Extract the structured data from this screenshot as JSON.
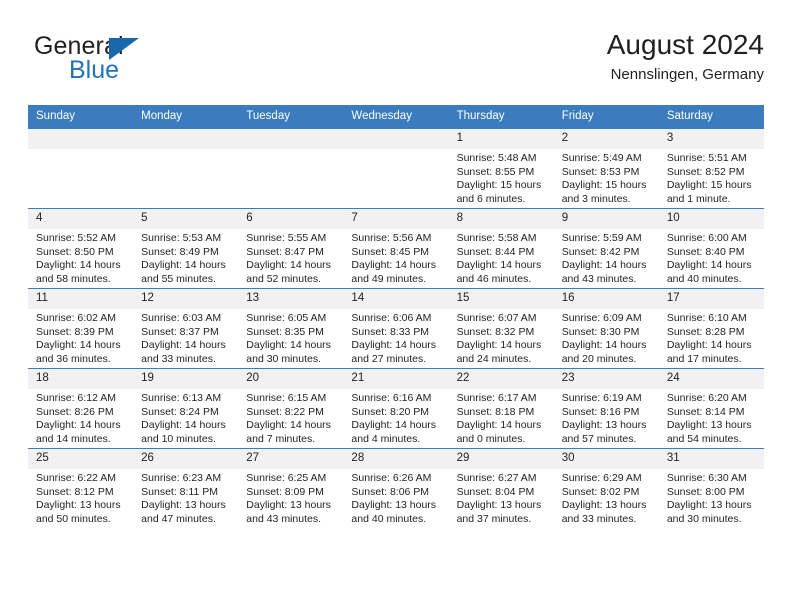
{
  "brand": {
    "name_top": "General",
    "name_bottom": "Blue",
    "flag_icon": "triangle-flag-icon",
    "accent_color": "#2272b8"
  },
  "header": {
    "title": "August 2024",
    "subtitle": "Nennslingen, Germany"
  },
  "calendar": {
    "header_color": "#3a7cbe",
    "daynum_band_color": "#f1f1f1",
    "weekdays": [
      "Sunday",
      "Monday",
      "Tuesday",
      "Wednesday",
      "Thursday",
      "Friday",
      "Saturday"
    ],
    "weeks": [
      [
        {
          "day": "",
          "lines": []
        },
        {
          "day": "",
          "lines": []
        },
        {
          "day": "",
          "lines": []
        },
        {
          "day": "",
          "lines": []
        },
        {
          "day": "1",
          "lines": [
            "Sunrise: 5:48 AM",
            "Sunset: 8:55 PM",
            "Daylight: 15 hours",
            "and 6 minutes."
          ]
        },
        {
          "day": "2",
          "lines": [
            "Sunrise: 5:49 AM",
            "Sunset: 8:53 PM",
            "Daylight: 15 hours",
            "and 3 minutes."
          ]
        },
        {
          "day": "3",
          "lines": [
            "Sunrise: 5:51 AM",
            "Sunset: 8:52 PM",
            "Daylight: 15 hours",
            "and 1 minute."
          ]
        }
      ],
      [
        {
          "day": "4",
          "lines": [
            "Sunrise: 5:52 AM",
            "Sunset: 8:50 PM",
            "Daylight: 14 hours",
            "and 58 minutes."
          ]
        },
        {
          "day": "5",
          "lines": [
            "Sunrise: 5:53 AM",
            "Sunset: 8:49 PM",
            "Daylight: 14 hours",
            "and 55 minutes."
          ]
        },
        {
          "day": "6",
          "lines": [
            "Sunrise: 5:55 AM",
            "Sunset: 8:47 PM",
            "Daylight: 14 hours",
            "and 52 minutes."
          ]
        },
        {
          "day": "7",
          "lines": [
            "Sunrise: 5:56 AM",
            "Sunset: 8:45 PM",
            "Daylight: 14 hours",
            "and 49 minutes."
          ]
        },
        {
          "day": "8",
          "lines": [
            "Sunrise: 5:58 AM",
            "Sunset: 8:44 PM",
            "Daylight: 14 hours",
            "and 46 minutes."
          ]
        },
        {
          "day": "9",
          "lines": [
            "Sunrise: 5:59 AM",
            "Sunset: 8:42 PM",
            "Daylight: 14 hours",
            "and 43 minutes."
          ]
        },
        {
          "day": "10",
          "lines": [
            "Sunrise: 6:00 AM",
            "Sunset: 8:40 PM",
            "Daylight: 14 hours",
            "and 40 minutes."
          ]
        }
      ],
      [
        {
          "day": "11",
          "lines": [
            "Sunrise: 6:02 AM",
            "Sunset: 8:39 PM",
            "Daylight: 14 hours",
            "and 36 minutes."
          ]
        },
        {
          "day": "12",
          "lines": [
            "Sunrise: 6:03 AM",
            "Sunset: 8:37 PM",
            "Daylight: 14 hours",
            "and 33 minutes."
          ]
        },
        {
          "day": "13",
          "lines": [
            "Sunrise: 6:05 AM",
            "Sunset: 8:35 PM",
            "Daylight: 14 hours",
            "and 30 minutes."
          ]
        },
        {
          "day": "14",
          "lines": [
            "Sunrise: 6:06 AM",
            "Sunset: 8:33 PM",
            "Daylight: 14 hours",
            "and 27 minutes."
          ]
        },
        {
          "day": "15",
          "lines": [
            "Sunrise: 6:07 AM",
            "Sunset: 8:32 PM",
            "Daylight: 14 hours",
            "and 24 minutes."
          ]
        },
        {
          "day": "16",
          "lines": [
            "Sunrise: 6:09 AM",
            "Sunset: 8:30 PM",
            "Daylight: 14 hours",
            "and 20 minutes."
          ]
        },
        {
          "day": "17",
          "lines": [
            "Sunrise: 6:10 AM",
            "Sunset: 8:28 PM",
            "Daylight: 14 hours",
            "and 17 minutes."
          ]
        }
      ],
      [
        {
          "day": "18",
          "lines": [
            "Sunrise: 6:12 AM",
            "Sunset: 8:26 PM",
            "Daylight: 14 hours",
            "and 14 minutes."
          ]
        },
        {
          "day": "19",
          "lines": [
            "Sunrise: 6:13 AM",
            "Sunset: 8:24 PM",
            "Daylight: 14 hours",
            "and 10 minutes."
          ]
        },
        {
          "day": "20",
          "lines": [
            "Sunrise: 6:15 AM",
            "Sunset: 8:22 PM",
            "Daylight: 14 hours",
            "and 7 minutes."
          ]
        },
        {
          "day": "21",
          "lines": [
            "Sunrise: 6:16 AM",
            "Sunset: 8:20 PM",
            "Daylight: 14 hours",
            "and 4 minutes."
          ]
        },
        {
          "day": "22",
          "lines": [
            "Sunrise: 6:17 AM",
            "Sunset: 8:18 PM",
            "Daylight: 14 hours",
            "and 0 minutes."
          ]
        },
        {
          "day": "23",
          "lines": [
            "Sunrise: 6:19 AM",
            "Sunset: 8:16 PM",
            "Daylight: 13 hours",
            "and 57 minutes."
          ]
        },
        {
          "day": "24",
          "lines": [
            "Sunrise: 6:20 AM",
            "Sunset: 8:14 PM",
            "Daylight: 13 hours",
            "and 54 minutes."
          ]
        }
      ],
      [
        {
          "day": "25",
          "lines": [
            "Sunrise: 6:22 AM",
            "Sunset: 8:12 PM",
            "Daylight: 13 hours",
            "and 50 minutes."
          ]
        },
        {
          "day": "26",
          "lines": [
            "Sunrise: 6:23 AM",
            "Sunset: 8:11 PM",
            "Daylight: 13 hours",
            "and 47 minutes."
          ]
        },
        {
          "day": "27",
          "lines": [
            "Sunrise: 6:25 AM",
            "Sunset: 8:09 PM",
            "Daylight: 13 hours",
            "and 43 minutes."
          ]
        },
        {
          "day": "28",
          "lines": [
            "Sunrise: 6:26 AM",
            "Sunset: 8:06 PM",
            "Daylight: 13 hours",
            "and 40 minutes."
          ]
        },
        {
          "day": "29",
          "lines": [
            "Sunrise: 6:27 AM",
            "Sunset: 8:04 PM",
            "Daylight: 13 hours",
            "and 37 minutes."
          ]
        },
        {
          "day": "30",
          "lines": [
            "Sunrise: 6:29 AM",
            "Sunset: 8:02 PM",
            "Daylight: 13 hours",
            "and 33 minutes."
          ]
        },
        {
          "day": "31",
          "lines": [
            "Sunrise: 6:30 AM",
            "Sunset: 8:00 PM",
            "Daylight: 13 hours",
            "and 30 minutes."
          ]
        }
      ]
    ]
  }
}
